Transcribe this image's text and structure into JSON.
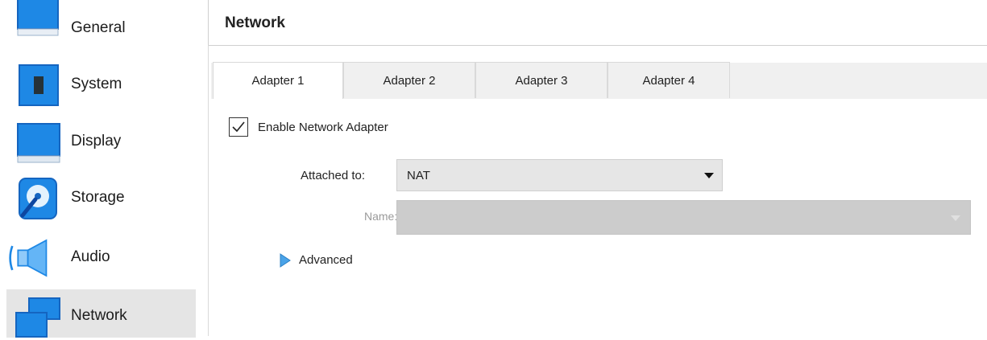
{
  "sidebar": {
    "items": [
      {
        "label": "General",
        "icon": "general-icon"
      },
      {
        "label": "System",
        "icon": "system-icon"
      },
      {
        "label": "Display",
        "icon": "display-icon"
      },
      {
        "label": "Storage",
        "icon": "storage-icon"
      },
      {
        "label": "Audio",
        "icon": "audio-icon"
      },
      {
        "label": "Network",
        "icon": "network-icon",
        "selected": true
      }
    ]
  },
  "header": {
    "title": "Network"
  },
  "tabs": [
    {
      "label": "Adapter 1",
      "active": true
    },
    {
      "label": "Adapter 2"
    },
    {
      "label": "Adapter 3"
    },
    {
      "label": "Adapter 4"
    }
  ],
  "adapter": {
    "enable_label": "Enable Network Adapter",
    "enabled": true,
    "attached_label": "Attached to:",
    "attached_value": "NAT",
    "name_label": "Name:",
    "name_value": "",
    "advanced_label": "Advanced"
  },
  "colors": {
    "icon_blue": "#1e88e5",
    "selected_bg": "#e5e5e5",
    "disabled_field": "#cccccc"
  }
}
